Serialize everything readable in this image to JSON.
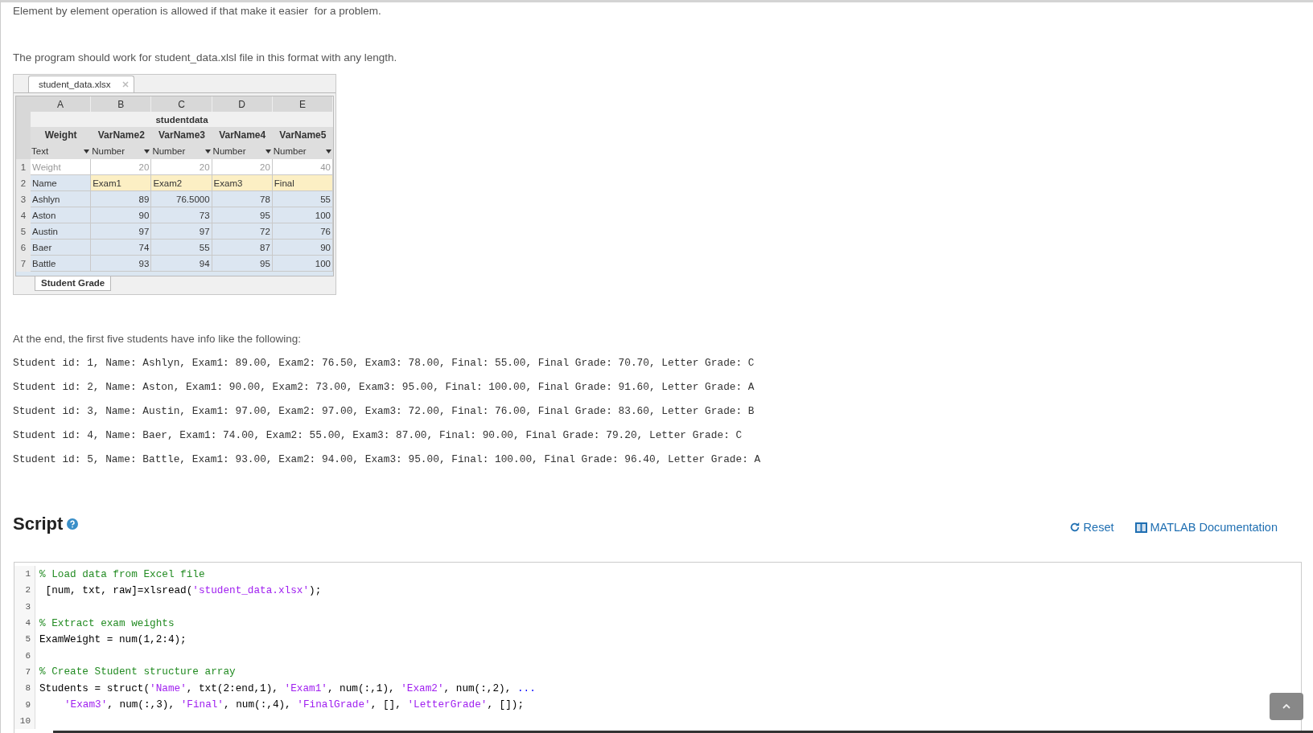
{
  "intro": [
    "Element by element operation is allowed if that make it easier  for a problem.",
    "The program should work for student_data.xlsl file in this format with any length."
  ],
  "spreadsheet": {
    "file_tab": "student_data.xlsx",
    "columns": [
      "A",
      "B",
      "C",
      "D",
      "E"
    ],
    "table_title": "studentdata",
    "var_names": [
      "Weight",
      "VarName2",
      "VarName3",
      "VarName4",
      "VarName5"
    ],
    "var_types": [
      "Text",
      "Number",
      "Number",
      "Number",
      "Number"
    ],
    "rows": [
      {
        "number": "1",
        "kind": "weights",
        "cells": [
          "Weight",
          "20",
          "20",
          "20",
          "40"
        ]
      },
      {
        "number": "2",
        "kind": "header",
        "cells": [
          "Name",
          "Exam1",
          "Exam2",
          "Exam3",
          "Final"
        ]
      },
      {
        "number": "3",
        "kind": "data",
        "cells": [
          "Ashlyn",
          "89",
          "76.5000",
          "78",
          "55"
        ]
      },
      {
        "number": "4",
        "kind": "data",
        "cells": [
          "Aston",
          "90",
          "73",
          "95",
          "100"
        ]
      },
      {
        "number": "5",
        "kind": "data",
        "cells": [
          "Austin",
          "97",
          "97",
          "72",
          "76"
        ]
      },
      {
        "number": "6",
        "kind": "data",
        "cells": [
          "Baer",
          "74",
          "55",
          "87",
          "90"
        ]
      },
      {
        "number": "7",
        "kind": "data",
        "cells": [
          "Battle",
          "93",
          "94",
          "95",
          "100"
        ]
      }
    ],
    "sheet_tab": "Student Grade"
  },
  "output_intro": "At the end, the first five students have info like the following:",
  "output_lines": [
    "Student id: 1, Name: Ashlyn, Exam1: 89.00, Exam2: 76.50, Exam3: 78.00, Final: 55.00, Final Grade: 70.70, Letter Grade: C",
    "Student id: 2, Name: Aston, Exam1: 90.00, Exam2: 73.00, Exam3: 95.00, Final: 100.00, Final Grade: 91.60, Letter Grade: A",
    "Student id: 3, Name: Austin, Exam1: 97.00, Exam2: 97.00, Exam3: 72.00, Final: 76.00, Final Grade: 83.60, Letter Grade: B",
    "Student id: 4, Name: Baer, Exam1: 74.00, Exam2: 55.00, Exam3: 87.00, Final: 90.00, Final Grade: 79.20, Letter Grade: C",
    "Student id: 5, Name: Battle, Exam1: 93.00, Exam2: 94.00, Exam3: 95.00, Final: 100.00, Final Grade: 96.40, Letter Grade: A"
  ],
  "script": {
    "title": "Script",
    "actions": [
      {
        "kind": "reset",
        "label": "Reset"
      },
      {
        "kind": "docs",
        "label": "MATLAB Documentation"
      }
    ],
    "lines": [
      {
        "number": "1",
        "tokens": [
          {
            "kind": "comment",
            "text": "% Load data from Excel file"
          }
        ]
      },
      {
        "number": "2",
        "tokens": [
          {
            "kind": "plain",
            "text": " [num, txt, raw]=xlsread("
          },
          {
            "kind": "string",
            "text": "'student_data.xlsx'"
          },
          {
            "kind": "plain",
            "text": ");"
          }
        ]
      },
      {
        "number": "3"
      },
      {
        "number": "4",
        "tokens": [
          {
            "kind": "comment",
            "text": "% Extract exam weights"
          }
        ]
      },
      {
        "number": "5",
        "tokens": [
          {
            "kind": "plain",
            "text": "ExamWeight = num(1,2:4);"
          }
        ]
      },
      {
        "number": "6"
      },
      {
        "number": "7",
        "tokens": [
          {
            "kind": "comment",
            "text": "% Create Student structure array"
          }
        ]
      },
      {
        "number": "8",
        "tokens": [
          {
            "kind": "plain",
            "text": "Students = struct("
          },
          {
            "kind": "string",
            "text": "'Name'"
          },
          {
            "kind": "plain",
            "text": ", txt(2:end,1), "
          },
          {
            "kind": "string",
            "text": "'Exam1'"
          },
          {
            "kind": "plain",
            "text": ", num(:,1), "
          },
          {
            "kind": "string",
            "text": "'Exam2'"
          },
          {
            "kind": "plain",
            "text": ", num(:,2), "
          },
          {
            "kind": "continuation",
            "text": "..."
          }
        ]
      },
      {
        "number": "9",
        "indented": true,
        "tokens": [
          {
            "kind": "string",
            "text": "'Exam3'"
          },
          {
            "kind": "plain",
            "text": ", num(:,3), "
          },
          {
            "kind": "string",
            "text": "'Final'"
          },
          {
            "kind": "plain",
            "text": ", num(:,4), "
          },
          {
            "kind": "string",
            "text": "'FinalGrade'"
          },
          {
            "kind": "plain",
            "text": ", [], "
          },
          {
            "kind": "string",
            "text": "'LetterGrade'"
          },
          {
            "kind": "plain",
            "text": ", []);"
          }
        ]
      },
      {
        "number": "10"
      }
    ]
  }
}
